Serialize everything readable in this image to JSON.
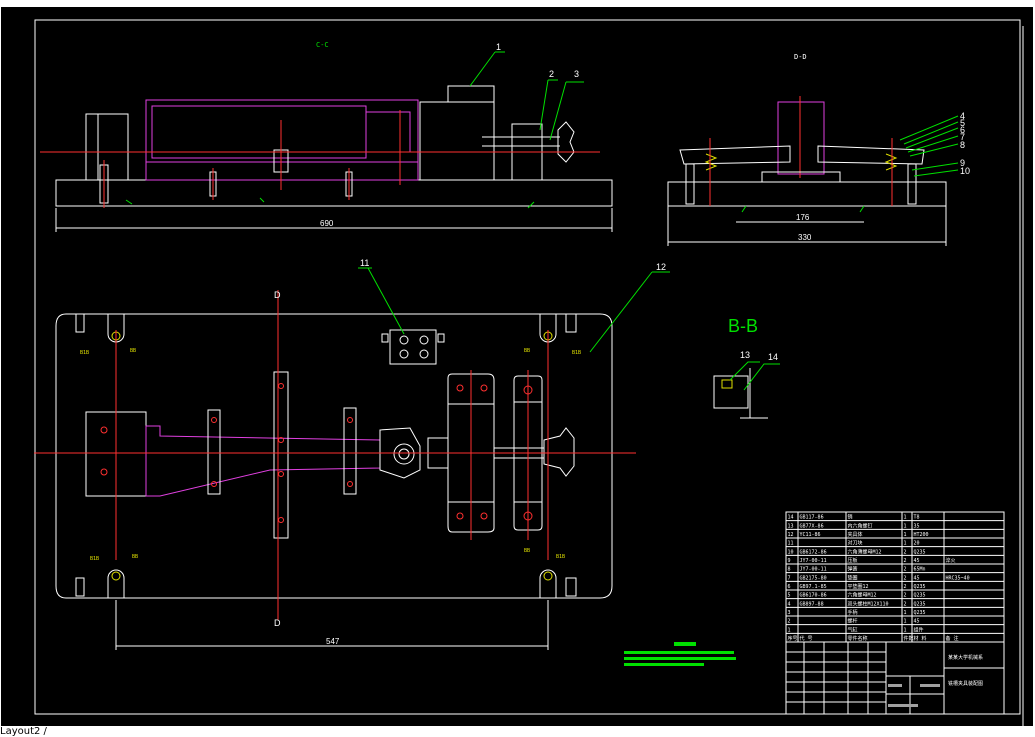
{
  "drawing": {
    "views": {
      "cc": "C-C",
      "dd": "D-D",
      "bb": "B-B"
    },
    "part_callouts": [
      "1",
      "2",
      "3",
      "4",
      "5",
      "6",
      "7",
      "8",
      "9",
      "10",
      "11",
      "12",
      "13",
      "14"
    ],
    "dimensions": {
      "cc_length": "690",
      "dd_inner": "176",
      "dd_outer": "330",
      "plan_length": "547",
      "section_mark_d_top": "D",
      "section_mark_d_bottom": "D"
    },
    "corner_labels": {
      "tl_a": "B1B",
      "tl_b": "BB",
      "tr_a": "BB",
      "tr_b": "B1B",
      "bl_a": "B1B",
      "bl_b": "BB",
      "br_a": "BB",
      "br_b": "B1B"
    },
    "bom": {
      "rows": [
        {
          "no": "14",
          "code": "GB117-86",
          "name": "销",
          "qty": "1",
          "mat": "T8",
          "note": ""
        },
        {
          "no": "13",
          "code": "GB77X-86",
          "name": "内六角螺钉",
          "qty": "1",
          "mat": "35",
          "note": ""
        },
        {
          "no": "12",
          "code": "YC11-86",
          "name": "夹具体",
          "qty": "1",
          "mat": "HT200",
          "note": ""
        },
        {
          "no": "11",
          "code": "",
          "name": "对刀块",
          "qty": "1",
          "mat": "20",
          "note": ""
        },
        {
          "no": "10",
          "code": "GB6172-86",
          "name": "六角薄螺母M12",
          "qty": "2",
          "mat": "Q235",
          "note": ""
        },
        {
          "no": "9",
          "code": "JY7-00-11",
          "name": "压板",
          "qty": "2",
          "mat": "45",
          "note": "淬火"
        },
        {
          "no": "8",
          "code": "JY7-00-11",
          "name": "弹簧",
          "qty": "2",
          "mat": "65Mn",
          "note": ""
        },
        {
          "no": "7",
          "code": "GB2175-80",
          "name": "垫圈",
          "qty": "2",
          "mat": "45",
          "note": "HRC35~40"
        },
        {
          "no": "6",
          "code": "GB97.1-85",
          "name": "平垫圈12",
          "qty": "2",
          "mat": "Q235",
          "note": ""
        },
        {
          "no": "5",
          "code": "GB6170-86",
          "name": "六角螺母M12",
          "qty": "2",
          "mat": "Q235",
          "note": ""
        },
        {
          "no": "4",
          "code": "GB897-88",
          "name": "双头螺柱M12X110",
          "qty": "2",
          "mat": "Q235",
          "note": ""
        },
        {
          "no": "3",
          "code": "",
          "name": "手柄",
          "qty": "1",
          "mat": "Q235",
          "note": ""
        },
        {
          "no": "2",
          "code": "",
          "name": "螺杆",
          "qty": "1",
          "mat": "45",
          "note": ""
        },
        {
          "no": "1",
          "code": "",
          "name": "气缸",
          "qty": "1",
          "mat": "组件",
          "note": ""
        }
      ],
      "header": {
        "no": "序号",
        "code": "代 号",
        "name": "零件名称",
        "qty": "件数",
        "mat": "材 料",
        "note": "备 注"
      }
    },
    "title_block": {
      "school": "某某大学机械系",
      "drawing_name": "铣槽夹具装配图"
    },
    "status_bar": "Layout2 /"
  },
  "colors": {
    "background": "#000000",
    "outline": "#ffffff",
    "centerline": "#ff3030",
    "hidden": "#e040e0",
    "hatch": "#00c8c8",
    "leader": "#00e000"
  }
}
